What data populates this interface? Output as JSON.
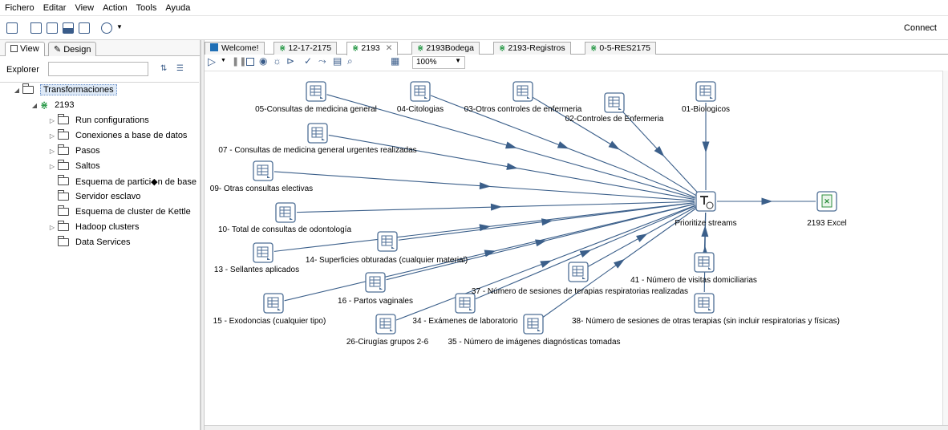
{
  "menu": [
    "Fichero",
    "Editar",
    "View",
    "Action",
    "Tools",
    "Ayuda"
  ],
  "toolbar": {
    "connect": "Connect"
  },
  "left_tabs": {
    "view": "View",
    "design": "Design"
  },
  "explorer": {
    "label": "Explorer",
    "search_value": ""
  },
  "tree": {
    "root": "Transformaciones",
    "transformation": "2193",
    "children": [
      "Run configurations",
      "Conexiones a base de datos",
      "Pasos",
      "Saltos",
      "Esquema de partici◆n de base",
      "Servidor esclavo",
      "Esquema de cluster de Kettle",
      "Hadoop clusters",
      "Data Services"
    ]
  },
  "editor_tabs": [
    "Welcome!",
    "12-17-2175",
    "2193",
    "2193Bodega",
    "2193-Registros",
    "0-5-RES2175"
  ],
  "zoom": "100%",
  "steps": {
    "s05": "05-Consultas de medicina general",
    "s04": "04-Citologias",
    "s03": "03-Otros controles de enfermeria",
    "s02": "02-Controles de Enfermeria",
    "s01": "01-Biologicos",
    "s07": "07 - Consultas de medicina general urgentes realizadas",
    "s09": "09- Otras consultas electivas",
    "s10": "10- Total de consultas de odontología",
    "s14": "14- Superficies obturadas (cualquier material)",
    "s13": "13 - Sellantes aplicados",
    "s16": "16 - Partos vaginales",
    "s15": "15 - Exodoncias (cualquier tipo)",
    "s26": "26-Cirugías grupos 2-6",
    "s34": "34 - Exámenes de laboratorio",
    "s35": "35 - Número de imágenes diagnósticas tomadas",
    "s37": "37 - Número de sesiones de terapias respiratorias realizadas",
    "s41": "41 - Número de visitas domiciliarias",
    "s38": "38- Número de sesiones de otras terapias (sin incluir respiratorias y físicas)",
    "prioritize": "Prioritize streams",
    "excel": "2193 Excel"
  },
  "colors": {
    "hop": "#3b5f8a",
    "icon_border": "#4d6e95",
    "excel_green": "#2f8f3f",
    "tab_green": "#2b9a4a"
  }
}
